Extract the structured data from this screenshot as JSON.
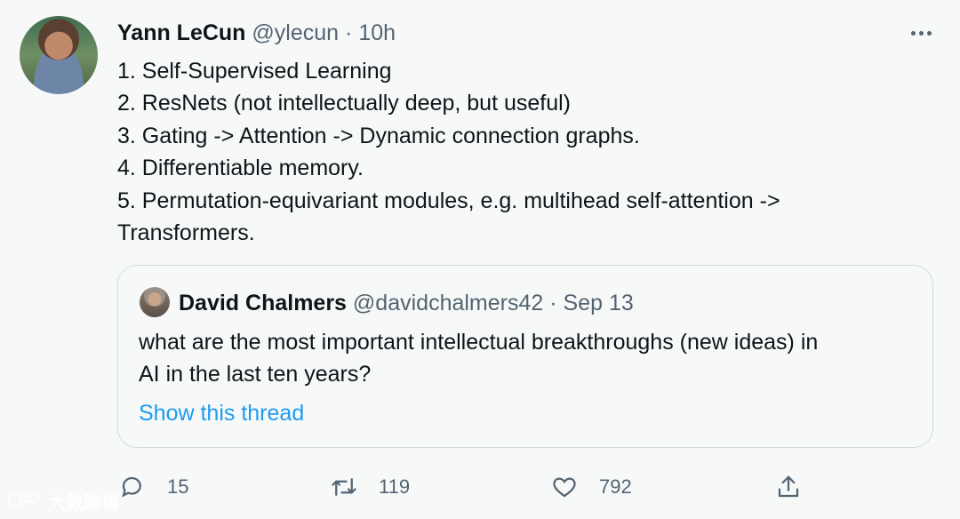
{
  "tweet": {
    "author_name": "Yann LeCun",
    "handle": "@ylecun",
    "separator": "·",
    "time": "10h",
    "more_icon": "more-horizontal-icon",
    "lines": [
      "1. Self-Supervised Learning",
      "2. ResNets (not intellectually deep, but useful)",
      "3. Gating -> Attention -> Dynamic connection graphs.",
      "4. Differentiable memory.",
      "5. Permutation-equivariant modules, e.g. multihead self-attention ->",
      "Transformers."
    ]
  },
  "quote": {
    "author_name": "David Chalmers",
    "handle": "@davidchalmers42",
    "separator": "·",
    "date": "Sep 13",
    "lines": [
      "what are the most important intellectual breakthroughs (new ideas) in",
      "AI in the last ten years?"
    ],
    "show_thread": "Show this thread"
  },
  "actions": {
    "reply": {
      "icon": "reply-icon",
      "count": "15"
    },
    "retweet": {
      "icon": "retweet-icon",
      "count": "119"
    },
    "like": {
      "icon": "heart-icon",
      "count": "792"
    },
    "share": {
      "icon": "share-icon"
    }
  },
  "watermark": {
    "text": "大数跨境"
  },
  "colors": {
    "background": "#f7f9f9",
    "text_primary": "#0f1419",
    "text_secondary": "#536471",
    "link": "#1d9bf0",
    "border": "#cfd9de"
  }
}
